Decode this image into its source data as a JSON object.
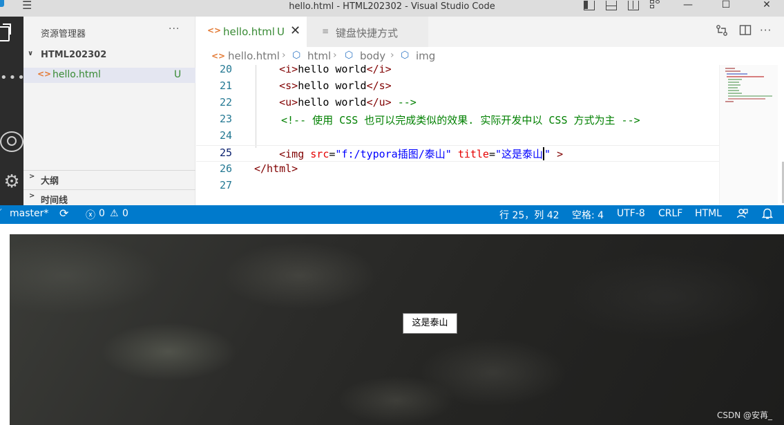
{
  "window": {
    "title": "hello.html - HTML202302 - Visual Studio Code",
    "menu_icon": "hamburger-menu-icon",
    "controls": {
      "minimize": "—",
      "maximize": "☐",
      "close": "✕"
    }
  },
  "sidebar": {
    "header": "资源管理器",
    "more_label": "···",
    "folder": {
      "chevron": "∨",
      "name": "HTML202302"
    },
    "file": {
      "icon": "<>",
      "name": "hello.html",
      "badge": "U"
    },
    "panels": [
      {
        "chevron": ">",
        "label": "大纲"
      },
      {
        "chevron": ">",
        "label": "时间线"
      }
    ]
  },
  "tabs": [
    {
      "icon": "<>",
      "label": "hello.html",
      "badge": "U",
      "close": "✕"
    },
    {
      "icon": "≡",
      "label": "键盘快捷方式"
    }
  ],
  "tab_actions": [
    "compare-changes-icon",
    "split-editor-icon",
    "more-actions-icon"
  ],
  "breadcrumb": {
    "file": "hello.html",
    "items": [
      "html",
      "body",
      "img"
    ]
  },
  "editor": {
    "lines": [
      {
        "num": "20"
      },
      {
        "num": "21"
      },
      {
        "num": "22"
      },
      {
        "num": "23"
      },
      {
        "num": "24"
      },
      {
        "num": "25"
      },
      {
        "num": "26"
      },
      {
        "num": "27"
      }
    ],
    "code": {
      "l20a": "<i>",
      "l20b": "hello world",
      "l20c": "</i>",
      "l21a": "<s>",
      "l21b": "hello world",
      "l21c": "</s>",
      "l22a": "<u>",
      "l22b": "hello world",
      "l22c": "</u>",
      "l22d": " -->",
      "l23": "<!-- 使用 CSS 也可以完成类似的效果. 实际开发中以 CSS 方式为主 -->",
      "l25_tag": "<img",
      "l25_attr1": "src",
      "l25_eq1": "=",
      "l25_val1": "\"f:/typora插图/泰山\"",
      "l25_attr2": "title",
      "l25_eq2": "=",
      "l25_val2a": "\"这是泰山",
      "l25_val2b": "\"",
      "l25_end": " >",
      "l26": "</html>"
    }
  },
  "statusbar": {
    "branch": "master*",
    "sync_icon": "sync-icon",
    "errors": "0",
    "warnings": "0",
    "position": "行 25，列 42",
    "spaces": "空格: 4",
    "encoding": "UTF-8",
    "eol": "CRLF",
    "language": "HTML"
  },
  "preview": {
    "tooltip": "这是泰山",
    "watermark": "CSDN @安苒_"
  },
  "colors": {
    "statusbar": "#007acc",
    "activitybar": "#2c2c2c",
    "untracked": "#388a34"
  }
}
